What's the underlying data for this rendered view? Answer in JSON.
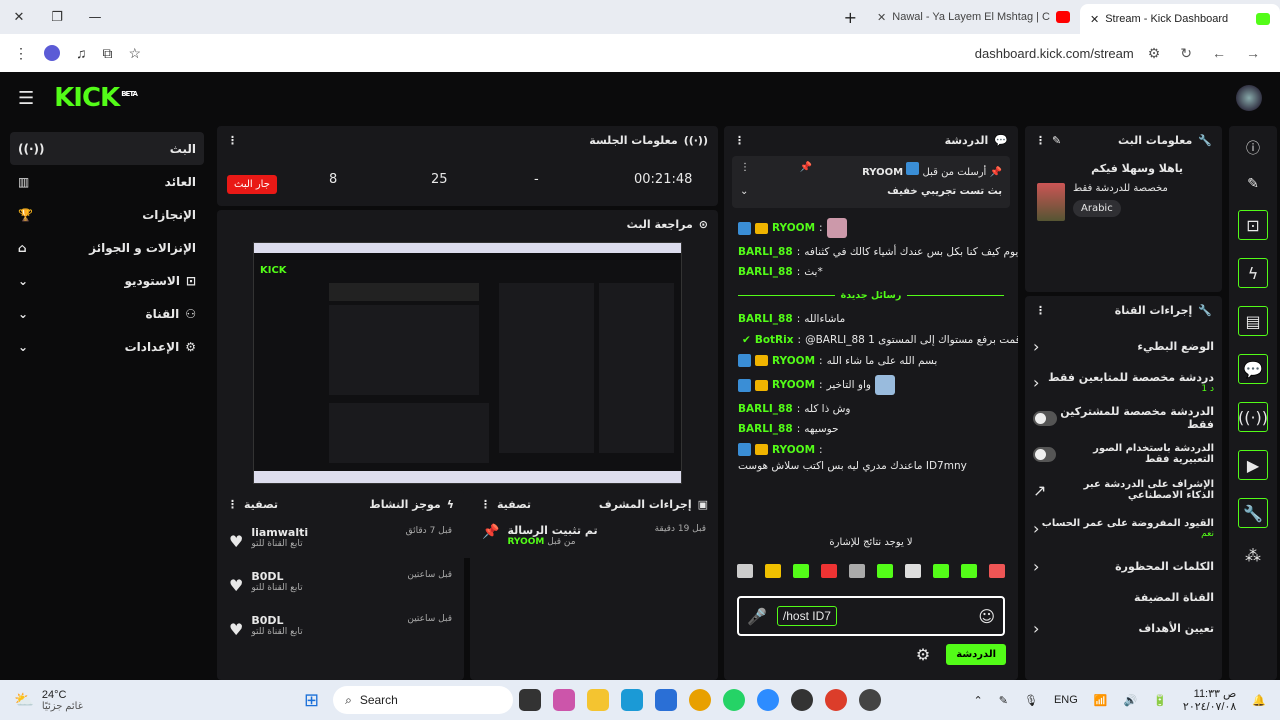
{
  "browser": {
    "tabs": [
      {
        "label": "Nawal - Ya Layem El Mshtag | C"
      },
      {
        "label": "Stream - Kick Dashboard"
      }
    ],
    "url": "dashboard.kick.com/stream"
  },
  "header": {
    "logo": "KICK",
    "beta": "BETA"
  },
  "sidebar": {
    "items": [
      {
        "label": "البث",
        "icon": "broadcast-icon"
      },
      {
        "label": "العائد",
        "icon": "chart-icon"
      },
      {
        "label": "الإنجازات",
        "icon": "trophy-icon"
      },
      {
        "label": "الإنزالات و الجوائز",
        "icon": "gift-icon"
      },
      {
        "label": "الاستوديو",
        "icon": "studio-icon"
      },
      {
        "label": "القناة",
        "icon": "channel-icon"
      },
      {
        "label": "الإعدادات",
        "icon": "settings-icon"
      }
    ]
  },
  "session": {
    "title": "معلومات الجلسة",
    "stop_label": "جار البث",
    "stats": [
      "8",
      "25",
      "-",
      "00:21:48"
    ]
  },
  "preview": {
    "title": "مراجعة البث"
  },
  "activity": {
    "title": "موجز النشاط",
    "filter": "تصفية",
    "items": [
      {
        "user": "liamwalti",
        "action": "تابع القناة للتو",
        "time": "قبل 7 دقائق"
      },
      {
        "user": "B0DL",
        "action": "تابع القناة للتو",
        "time": "قبل ساعتين"
      },
      {
        "user": "B0DL",
        "action": "تابع القناة للتو",
        "time": "قبل ساعتين"
      }
    ]
  },
  "mod": {
    "title": "إجراءات المشرف",
    "filter": "تصفية",
    "item_title": "تم تثبيت الرسالة",
    "by": "من قبل",
    "user": "RYOOM",
    "time": "قبل 19 دقيقة"
  },
  "chat": {
    "title": "الدردشة",
    "pinned_by": "أرسلت من قبل",
    "pinned_user": "RYOOM",
    "pinned_text": "بث تست تجريبي خفيف",
    "new_messages": "رسائل جديدة",
    "messages": [
      {
        "user": "RYOOM",
        "text": "",
        "badges": true
      },
      {
        "user": "BARLI_88",
        "text": "ريوم كيف كنا بكل بس عندك أشياء كالك في كثنافه",
        "badges": false
      },
      {
        "user": "BARLI_88",
        "text": "بث*",
        "badges": false
      },
      {
        "user": "BARLI_88",
        "text": "ماشاءالله",
        "badges": false
      },
      {
        "user": "BotRix",
        "text": "@BARLI_88 قمت برفع مستواك إلى المستوى 1",
        "badges": true
      },
      {
        "user": "RYOOM",
        "text": "بسم الله على ما شاء الله",
        "badges": true
      },
      {
        "user": "RYOOM",
        "text": "واو التاخير",
        "badges": true
      },
      {
        "user": "BARLI_88",
        "text": "وش ذا كله",
        "badges": false
      },
      {
        "user": "BARLI_88",
        "text": "حوسيهه",
        "badges": false
      },
      {
        "user": "RYOOM",
        "text": "ماعندك مدري ليه بس اكتب سلاش هوست ID7mny",
        "badges": true
      }
    ],
    "no_results": "لا يوجد نتائج للإشارة",
    "input_value": "/host ID7",
    "send_label": "الدردشة"
  },
  "stream_info": {
    "title": "معلومات البث",
    "stream_title": "ياهلا وسهلا فيكم",
    "category": "مخصصة للدردشة فقط",
    "language": "Arabic"
  },
  "channel_actions": {
    "title": "إجراءات القناة",
    "items": [
      {
        "label": "الوضع البطيء",
        "sub": "",
        "type": "chevron"
      },
      {
        "label": "دردشة مخصصة للمتابعين فقط",
        "sub": "1 د",
        "type": "chevron"
      },
      {
        "label": "الدردشة مخصصة للمشتركين فقط",
        "sub": "",
        "type": "toggle"
      },
      {
        "label": "الدردشة باستخدام الصور التعبيرية فقط",
        "sub": "",
        "type": "toggle"
      },
      {
        "label": "الإشراف على الدردشة عبر الذكاء الاصطناعي",
        "sub": "",
        "type": "external"
      },
      {
        "label": "القيود المفروضة على عمر الحساب",
        "sub": "نعم",
        "type": "chevron"
      },
      {
        "label": "الكلمات المحظورة",
        "sub": "",
        "type": "chevron"
      },
      {
        "label": "القناة المضيفة",
        "sub": "",
        "type": "none"
      },
      {
        "label": "تعيين الأهداف",
        "sub": "",
        "type": "chevron"
      }
    ]
  },
  "taskbar": {
    "weather_temp": "24°C",
    "weather_desc": "غائم جزئيًا",
    "search": "Search",
    "lang": "ENG",
    "time": "ص 11:٣٣",
    "date": "٢٠٢٤/٠٧/٠٨"
  }
}
